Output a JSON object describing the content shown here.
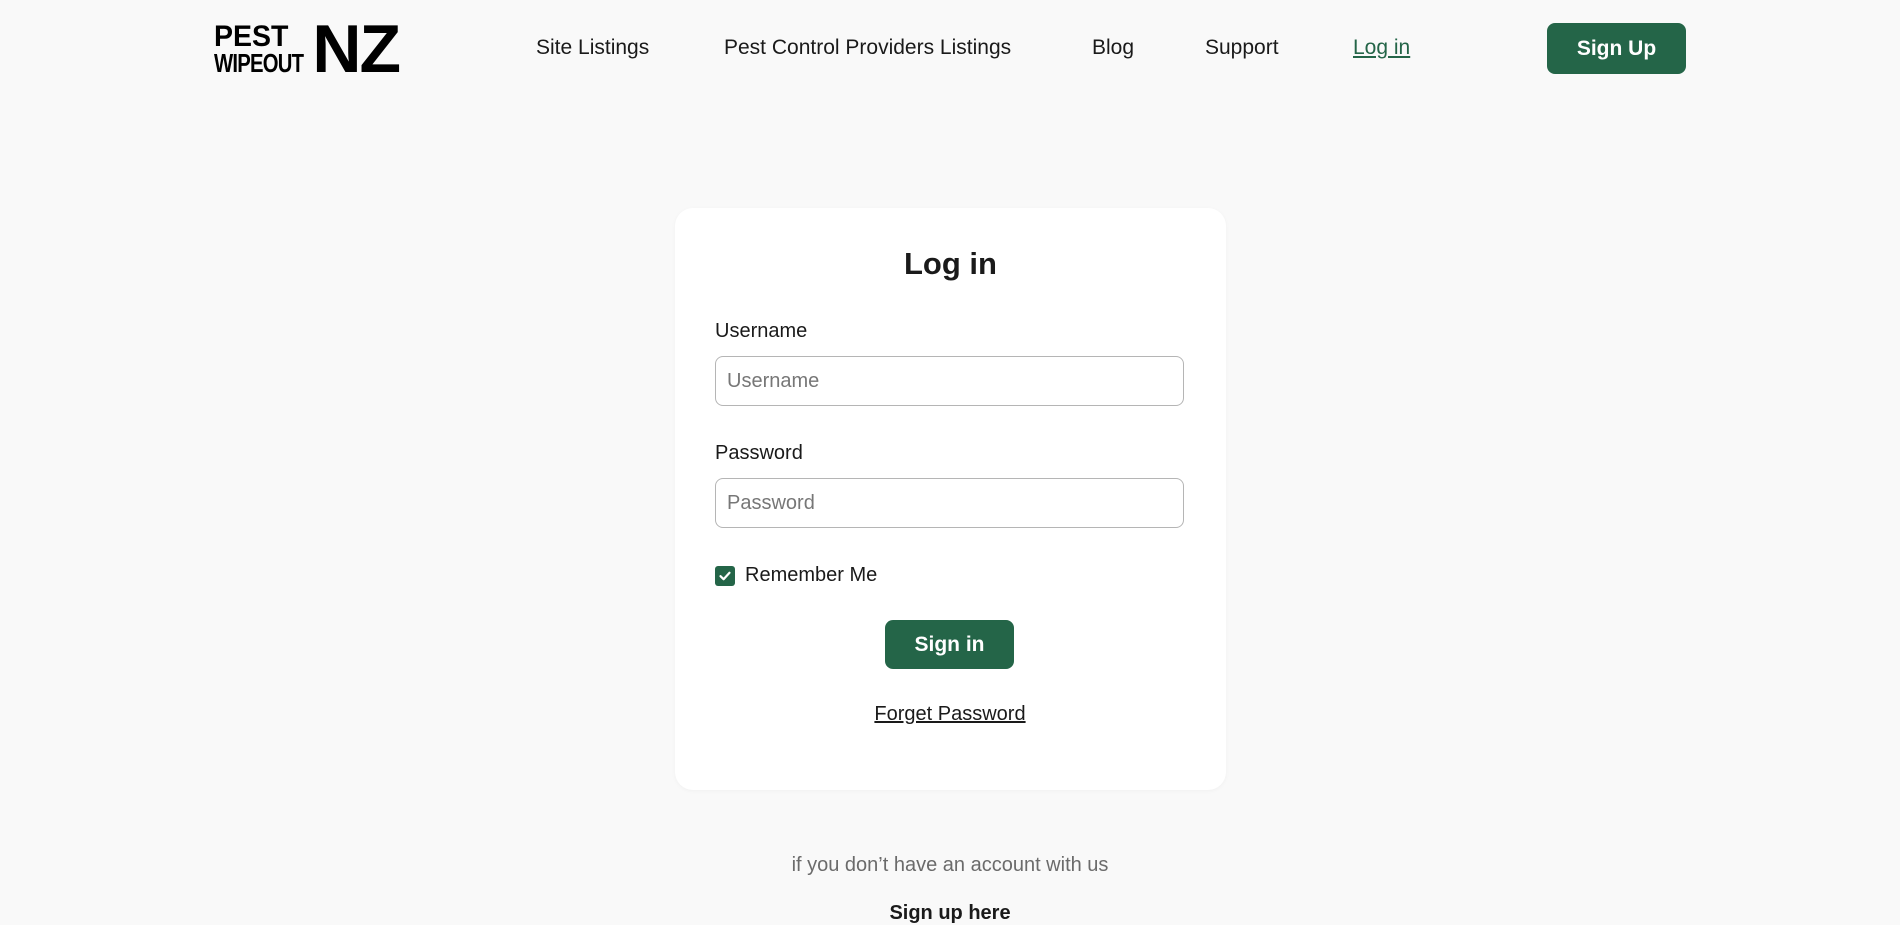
{
  "brand": {
    "logo_top": "PEST",
    "logo_bottom": "WIPEOUT",
    "logo_mark": "NZ"
  },
  "nav": {
    "items": [
      {
        "label": "Site Listings"
      },
      {
        "label": "Pest Control Providers Listings"
      },
      {
        "label": "Blog"
      },
      {
        "label": "Support"
      },
      {
        "label": "Log in"
      }
    ],
    "signup_label": "Sign Up"
  },
  "login": {
    "title": "Log in",
    "username_label": "Username",
    "username_placeholder": "Username",
    "username_value": "",
    "password_label": "Password",
    "password_placeholder": "Password",
    "password_value": "",
    "remember_label": "Remember Me",
    "remember_checked": true,
    "signin_label": "Sign in",
    "forget_label": "Forget Password"
  },
  "footer": {
    "no_account_text": "if you don’t have an account with us",
    "signup_here_label": "Sign up here"
  },
  "colors": {
    "accent": "#246548",
    "background": "#f9f9f9",
    "card": "#ffffff"
  },
  "icons": {
    "checkbox": "checkmark-icon"
  }
}
